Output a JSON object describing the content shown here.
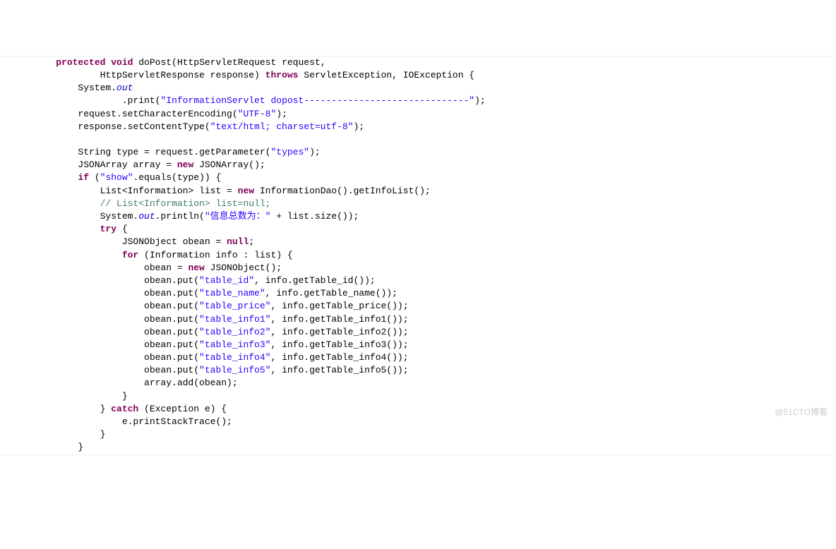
{
  "watermark": "@51CTO博客",
  "tokens": [
    {
      "cls": "line",
      "indent": "    ",
      "parts": [
        {
          "t": "protected ",
          "c": "kw"
        },
        {
          "t": "void ",
          "c": "kw"
        },
        {
          "t": "doPost(HttpServletRequest request,",
          "c": ""
        }
      ]
    },
    {
      "cls": "line",
      "indent": "            ",
      "parts": [
        {
          "t": "HttpServletResponse response) ",
          "c": ""
        },
        {
          "t": "throws ",
          "c": "kw"
        },
        {
          "t": "ServletException, IOException {",
          "c": ""
        }
      ]
    },
    {
      "cls": "line",
      "indent": "        ",
      "parts": [
        {
          "t": "System.",
          "c": ""
        },
        {
          "t": "out",
          "c": "field"
        }
      ]
    },
    {
      "cls": "line",
      "indent": "                ",
      "parts": [
        {
          "t": ".print(",
          "c": ""
        },
        {
          "t": "\"InformationServlet dopost------------------------------\"",
          "c": "str"
        },
        {
          "t": ");",
          "c": ""
        }
      ]
    },
    {
      "cls": "line",
      "indent": "        ",
      "parts": [
        {
          "t": "request.setCharacterEncoding(",
          "c": ""
        },
        {
          "t": "\"UTF-8\"",
          "c": "str"
        },
        {
          "t": ");",
          "c": ""
        }
      ]
    },
    {
      "cls": "line",
      "indent": "        ",
      "parts": [
        {
          "t": "response.setContentType(",
          "c": ""
        },
        {
          "t": "\"text/html; charset=utf-8\"",
          "c": "str"
        },
        {
          "t": ");",
          "c": ""
        }
      ]
    },
    {
      "cls": "line",
      "indent": "",
      "parts": [
        {
          "t": " ",
          "c": ""
        }
      ]
    },
    {
      "cls": "line",
      "indent": "        ",
      "parts": [
        {
          "t": "String type = request.getParameter(",
          "c": ""
        },
        {
          "t": "\"types\"",
          "c": "str"
        },
        {
          "t": ");",
          "c": ""
        }
      ]
    },
    {
      "cls": "line",
      "indent": "        ",
      "parts": [
        {
          "t": "JSONArray array = ",
          "c": ""
        },
        {
          "t": "new ",
          "c": "kw"
        },
        {
          "t": "JSONArray();",
          "c": ""
        }
      ]
    },
    {
      "cls": "line",
      "indent": "        ",
      "parts": [
        {
          "t": "if ",
          "c": "kw"
        },
        {
          "t": "(",
          "c": ""
        },
        {
          "t": "\"show\"",
          "c": "str"
        },
        {
          "t": ".equals(type)) {",
          "c": ""
        }
      ]
    },
    {
      "cls": "line",
      "indent": "            ",
      "parts": [
        {
          "t": "List<Information> list = ",
          "c": ""
        },
        {
          "t": "new ",
          "c": "kw"
        },
        {
          "t": "InformationDao().getInfoList();",
          "c": ""
        }
      ]
    },
    {
      "cls": "line",
      "indent": "            ",
      "parts": [
        {
          "t": "// List<Information> list=null;",
          "c": "cmt"
        }
      ]
    },
    {
      "cls": "line",
      "indent": "            ",
      "parts": [
        {
          "t": "System.",
          "c": ""
        },
        {
          "t": "out",
          "c": "field"
        },
        {
          "t": ".println(",
          "c": ""
        },
        {
          "t": "\"信息总数为：\"",
          "c": "str"
        },
        {
          "t": " + list.size());",
          "c": ""
        }
      ]
    },
    {
      "cls": "line",
      "indent": "            ",
      "parts": [
        {
          "t": "try ",
          "c": "kw"
        },
        {
          "t": "{",
          "c": ""
        }
      ]
    },
    {
      "cls": "line",
      "indent": "                ",
      "parts": [
        {
          "t": "JSONObject obean = ",
          "c": ""
        },
        {
          "t": "null",
          "c": "kw"
        },
        {
          "t": ";",
          "c": ""
        }
      ]
    },
    {
      "cls": "line",
      "indent": "                ",
      "parts": [
        {
          "t": "for ",
          "c": "kw"
        },
        {
          "t": "(Information info : list) {",
          "c": ""
        }
      ]
    },
    {
      "cls": "line",
      "indent": "                    ",
      "parts": [
        {
          "t": "obean = ",
          "c": ""
        },
        {
          "t": "new ",
          "c": "kw"
        },
        {
          "t": "JSONObject();",
          "c": ""
        }
      ]
    },
    {
      "cls": "line",
      "indent": "                    ",
      "parts": [
        {
          "t": "obean.put(",
          "c": ""
        },
        {
          "t": "\"table_id\"",
          "c": "str"
        },
        {
          "t": ", info.getTable_id());",
          "c": ""
        }
      ]
    },
    {
      "cls": "line",
      "indent": "                    ",
      "parts": [
        {
          "t": "obean.put(",
          "c": ""
        },
        {
          "t": "\"table_name\"",
          "c": "str"
        },
        {
          "t": ", info.getTable_name());",
          "c": ""
        }
      ]
    },
    {
      "cls": "line",
      "indent": "                    ",
      "parts": [
        {
          "t": "obean.put(",
          "c": ""
        },
        {
          "t": "\"table_price\"",
          "c": "str"
        },
        {
          "t": ", info.getTable_price());",
          "c": ""
        }
      ]
    },
    {
      "cls": "line",
      "indent": "                    ",
      "parts": [
        {
          "t": "obean.put(",
          "c": ""
        },
        {
          "t": "\"table_info1\"",
          "c": "str"
        },
        {
          "t": ", info.getTable_info1());",
          "c": ""
        }
      ]
    },
    {
      "cls": "line",
      "indent": "                    ",
      "parts": [
        {
          "t": "obean.put(",
          "c": ""
        },
        {
          "t": "\"table_info2\"",
          "c": "str"
        },
        {
          "t": ", info.getTable_info2());",
          "c": ""
        }
      ]
    },
    {
      "cls": "line",
      "indent": "                    ",
      "parts": [
        {
          "t": "obean.put(",
          "c": ""
        },
        {
          "t": "\"table_info3\"",
          "c": "str"
        },
        {
          "t": ", info.getTable_info3());",
          "c": ""
        }
      ]
    },
    {
      "cls": "line",
      "indent": "                    ",
      "parts": [
        {
          "t": "obean.put(",
          "c": ""
        },
        {
          "t": "\"table_info4\"",
          "c": "str"
        },
        {
          "t": ", info.getTable_info4());",
          "c": ""
        }
      ]
    },
    {
      "cls": "line",
      "indent": "                    ",
      "parts": [
        {
          "t": "obean.put(",
          "c": ""
        },
        {
          "t": "\"table_info5\"",
          "c": "str"
        },
        {
          "t": ", info.getTable_info5());",
          "c": ""
        }
      ]
    },
    {
      "cls": "line",
      "indent": "                    ",
      "parts": [
        {
          "t": "array.add(obean);",
          "c": ""
        }
      ]
    },
    {
      "cls": "line",
      "indent": "                ",
      "parts": [
        {
          "t": "}",
          "c": ""
        }
      ]
    },
    {
      "cls": "line",
      "indent": "            ",
      "parts": [
        {
          "t": "} ",
          "c": ""
        },
        {
          "t": "catch ",
          "c": "kw"
        },
        {
          "t": "(Exception e) {",
          "c": ""
        }
      ]
    },
    {
      "cls": "line",
      "indent": "                ",
      "parts": [
        {
          "t": "e.printStackTrace();",
          "c": ""
        }
      ]
    },
    {
      "cls": "line",
      "indent": "            ",
      "parts": [
        {
          "t": "}",
          "c": ""
        }
      ]
    },
    {
      "cls": "line",
      "indent": "        ",
      "parts": [
        {
          "t": "}",
          "c": ""
        }
      ]
    }
  ]
}
